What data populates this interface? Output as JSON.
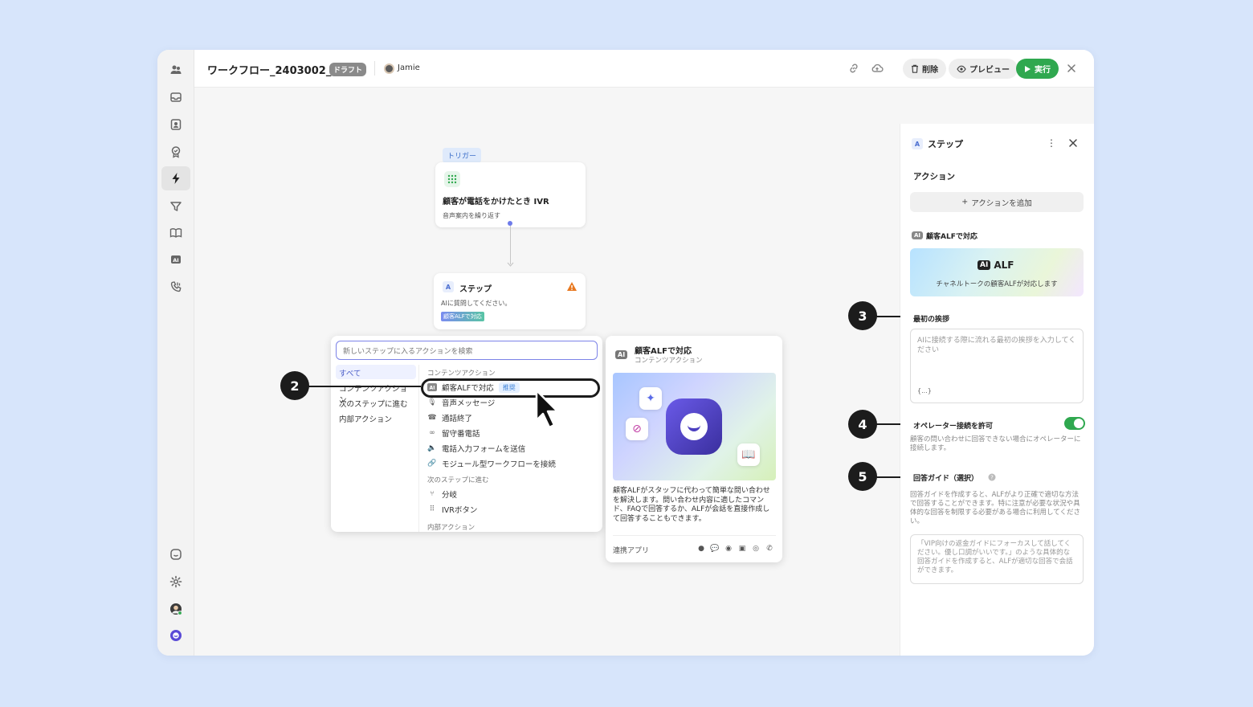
{
  "header": {
    "workflow_title": "ワークフロー_2403002_1",
    "draft_badge": "ドラフト",
    "user_name": "Jamie",
    "delete_label": "削除",
    "preview_label": "プレビュー",
    "run_label": "実行"
  },
  "sidebar": {
    "icons": [
      "team-icon",
      "inbox-icon",
      "contacts-icon",
      "badge-icon",
      "workflow-icon",
      "campaign-icon",
      "docs-icon",
      "ai-icon",
      "call-icon",
      "chat-icon",
      "settings-icon",
      "profile-avatar",
      "app-logo-icon"
    ],
    "active": "workflow-icon"
  },
  "canvas": {
    "trigger_tag": "トリガー",
    "trigger_title": "顧客が電話をかけたとき IVR",
    "trigger_sub": "音声案内を繰り返す",
    "step_icon_letter": "A",
    "step_title": "ステップ",
    "step_sub": "AIに質問してください。",
    "step_chip": "顧客ALFで対応"
  },
  "picker": {
    "search_placeholder": "新しいステップに入るアクションを検索",
    "categories": [
      "すべて",
      "コンテンツアクション",
      "次のステップに進む",
      "内部アクション"
    ],
    "active_category": "すべて",
    "group1_header": "コンテンツアクション",
    "group1_items": [
      {
        "icon": "ai-icon",
        "label": "顧客ALFで対応",
        "badge": "推奨"
      },
      {
        "icon": "mic-icon",
        "label": "音声メッセージ"
      },
      {
        "icon": "hangup-icon",
        "label": "通話終了"
      },
      {
        "icon": "voicemail-icon",
        "label": "留守番電話"
      },
      {
        "icon": "speaker-icon",
        "label": "電話入力フォームを送信"
      },
      {
        "icon": "link-icon",
        "label": "モジュール型ワークフローを接続"
      }
    ],
    "group2_header": "次のステップに進む",
    "group2_items": [
      {
        "icon": "branch-icon",
        "label": "分岐"
      },
      {
        "icon": "keypad-icon",
        "label": "IVRボタン"
      }
    ],
    "group3_header": "内部アクション"
  },
  "preview_card": {
    "ai_tag": "AI",
    "title": "顧客ALFで対応",
    "subtitle": "コンテンツアクション",
    "description": "顧客ALFがスタッフに代わって簡単な問い合わせを解決します。問い合わせ内容に適したコマンド、FAQで回答するか、ALFが会話を直接作成して回答することもできます。",
    "apps_label": "連携アプリ",
    "app_icons": [
      "chat-app-icon",
      "talk-app-icon",
      "line-app-icon",
      "kakao-app-icon",
      "instagram-app-icon",
      "phone-app-icon"
    ]
  },
  "callouts": [
    "2",
    "3",
    "4",
    "5"
  ],
  "panel": {
    "icon_letter": "A",
    "title": "ステップ",
    "actions_heading": "アクション",
    "add_action_label": "アクションを追加",
    "alf_section_tag": "AI",
    "alf_section_label": "顧客ALFで対応",
    "alf_banner_tag": "AI",
    "alf_banner_title": "ALF",
    "alf_banner_sub": "チャネルトークの顧客ALFが対応します",
    "greeting_label": "最初の挨拶",
    "greeting_placeholder": "AIに接続する際に流れる最初の挨拶を入力してください",
    "greeting_var": "{...}",
    "operator_label": "オペレーター接続を許可",
    "operator_enabled": true,
    "operator_help": "顧客の問い合わせに回答できない場合にオペレーターに接続します。",
    "guide_label": "回答ガイド（選択）",
    "guide_help": "回答ガイドを作成すると、ALFがより正確で適切な方法で回答することができます。特に注意が必要な状況や具体的な回答を制限する必要がある場合に利用してください。",
    "guide_placeholder": "「VIP向けの返金ガイドにフォーカスして話してください。優し口調がいいです。」のような具体的な回答ガイドを作成すると、ALFが適切な回答で会話ができます。"
  },
  "colors": {
    "accent": "#6e7bea",
    "run_green": "#2fa84f",
    "page_bg": "#d7e5fb"
  }
}
